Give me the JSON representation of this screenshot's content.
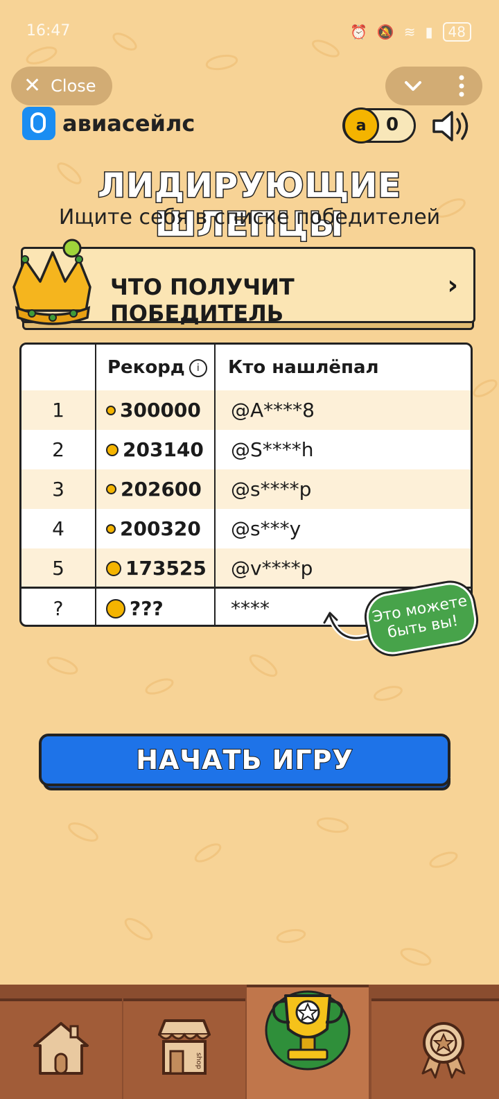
{
  "status_bar": {
    "time": "16:47",
    "battery": "48"
  },
  "top_bar": {
    "close_label": "Close"
  },
  "brand": {
    "name": "авиасейлс"
  },
  "wallet": {
    "coin_symbol": "a",
    "balance": "0"
  },
  "header": {
    "title": "ЛИДИРУЮЩИЕ ШЛЕПЦЫ",
    "subtitle": "Ищите себя в списке победителей"
  },
  "prize_banner": {
    "label": "ЧТО ПОЛУЧИТ ПОБЕДИТЕЛЬ",
    "chevron": "›"
  },
  "leaderboard": {
    "columns": {
      "record": "Рекорд",
      "info_icon": "i",
      "who": "Кто нашлёпал"
    },
    "rows": [
      {
        "rank": "1",
        "score": "300000",
        "user": "@A****8"
      },
      {
        "rank": "2",
        "score": "203140",
        "user": "@S****h"
      },
      {
        "rank": "3",
        "score": "202600",
        "user": "@s****p"
      },
      {
        "rank": "4",
        "score": "200320",
        "user": "@s***y"
      },
      {
        "rank": "5",
        "score": "173525",
        "user": "@v****p"
      }
    ],
    "me": {
      "rank": "?",
      "score": "???",
      "user": "****"
    }
  },
  "badge": {
    "line1": "Это можете",
    "line2": "быть вы!"
  },
  "start_button": {
    "label": "НАЧАТЬ ИГРУ"
  },
  "bottom_nav": {
    "tabs": [
      {
        "icon": "home-icon",
        "active": false
      },
      {
        "icon": "shop-icon",
        "active": false,
        "sign": "shop"
      },
      {
        "icon": "trophy-icon",
        "active": true
      },
      {
        "icon": "medal-icon",
        "active": false
      }
    ]
  },
  "colors": {
    "background": "#f7d396",
    "accent_blue": "#1e73e8",
    "coin": "#f4b400",
    "badge_green": "#47a34a",
    "nav_brown": "#8a4d2f"
  }
}
